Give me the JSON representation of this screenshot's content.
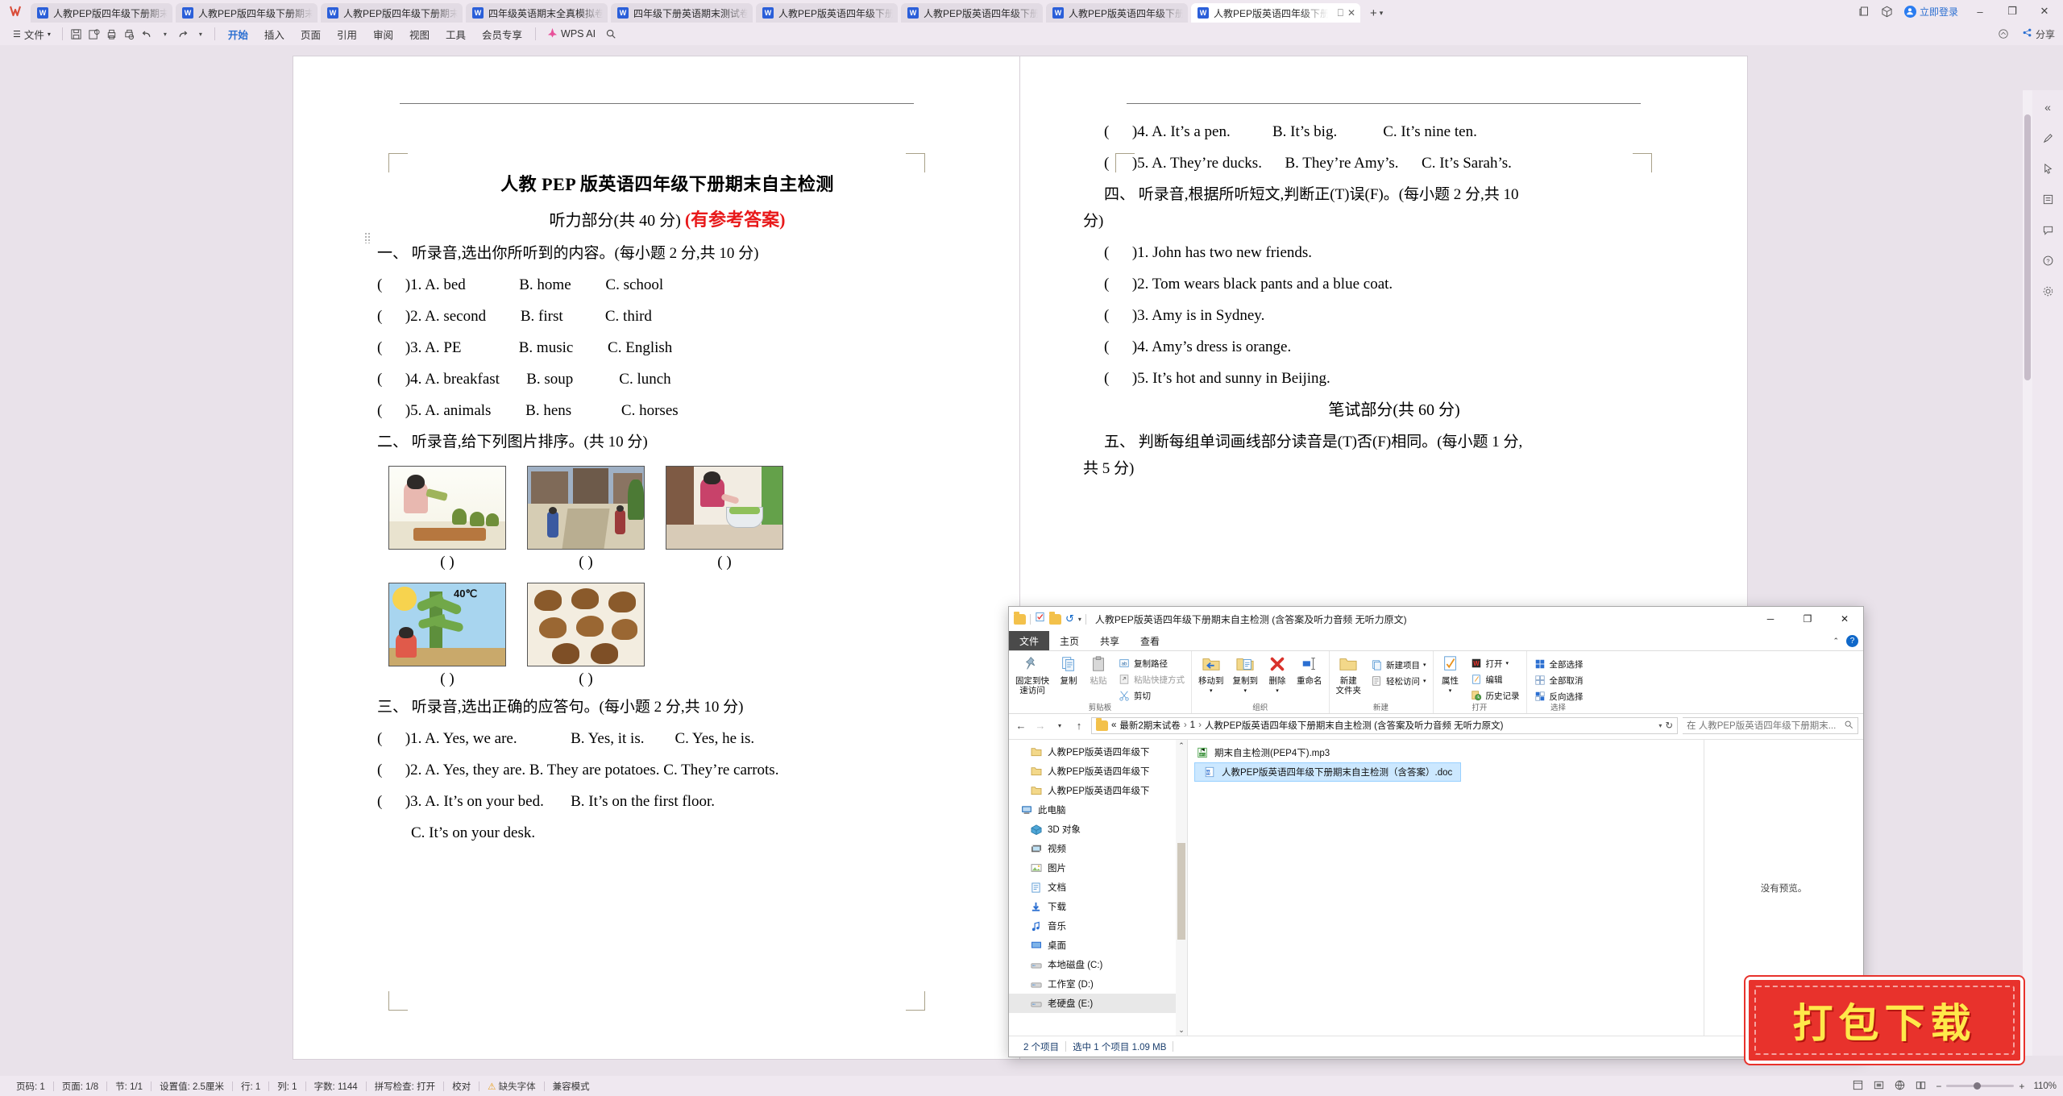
{
  "app": {
    "tabs": [
      {
        "label": "人教PEP版四年级下册期末阶段质量检",
        "icon": "word-icon",
        "active": false
      },
      {
        "label": "人教PEP版四年级下册期末阶段质量检",
        "icon": "word-icon",
        "active": false
      },
      {
        "label": "人教PEP版四年级下册期末阶段质量检",
        "icon": "word-icon",
        "active": false
      },
      {
        "label": "四年级英语期末全真模拟卷.doc",
        "icon": "word-icon",
        "active": false
      },
      {
        "label": "四年级下册英语期末测试卷(含答案).d",
        "icon": "word-icon",
        "active": false
      },
      {
        "label": "人教PEP版英语四年级下册期末测试卷",
        "icon": "word-icon",
        "active": false
      },
      {
        "label": "人教PEP版英语四年级下册期末测试卷",
        "icon": "word-icon",
        "active": false
      },
      {
        "label": "人教PEP版英语四年级下册期末达标",
        "icon": "word-icon",
        "active": false
      },
      {
        "label": "人教PEP版英语四年级下册期末自主检",
        "icon": "word-icon",
        "active": true
      }
    ],
    "new_tab_label": "+",
    "login_label": "立即登录",
    "min_label": "–",
    "restore_label": "❐",
    "close_label": "✕"
  },
  "ribbon": {
    "file_label": "文件",
    "tabs": [
      {
        "label": "开始",
        "active": true
      },
      {
        "label": "插入",
        "active": false
      },
      {
        "label": "页面",
        "active": false
      },
      {
        "label": "引用",
        "active": false
      },
      {
        "label": "审阅",
        "active": false
      },
      {
        "label": "视图",
        "active": false
      },
      {
        "label": "工具",
        "active": false
      },
      {
        "label": "会员专享",
        "active": false
      }
    ],
    "ai_label": "WPS AI",
    "search_label": "搜索",
    "share_label": "分享"
  },
  "document": {
    "title": "人教 PEP 版英语四年级下册期末自主检测",
    "subtitle_plain": "听力部分(共 40 分) ",
    "subtitle_red": "(有参考答案)",
    "left_page": {
      "section1": "一、 听录音,选出你所听到的内容。(每小题 2 分,共 10 分)",
      "q1": [
        "(      )1. A. bed              B. home         C. school",
        "(      )2. A. second         B. first           C. third",
        "(      )3. A. PE               B. music         C. English",
        "(      )4. A. breakfast       B. soup            C. lunch",
        "(      )5. A. animals         B. hens             C. horses"
      ],
      "section2": "二、 听录音,给下列图片排序。(共 10 分)",
      "bracket": "(        )",
      "image_alt_row1": [
        "girl-watering-plants",
        "village-street-scene",
        "girl-washing-vegetables"
      ],
      "image_alt_row2": [
        "sunny-40c-weather",
        "brown-hens"
      ],
      "temperature_label": "40℃",
      "section3": "三、 听录音,选出正确的应答句。(每小题 2 分,共 10 分)",
      "q3": [
        "(      )1. A. Yes, we are.              B. Yes, it is.        C. Yes, he is.",
        "(      )2. A. Yes, they are. B. They are potatoes. C. They’re carrots.",
        "(      )3. A. It’s on your bed.       B. It’s on the first floor.",
        "C. It’s on your desk."
      ]
    },
    "right_page": {
      "q3cont": [
        "(      )4. A. It’s a pen.           B. It’s big.            C. It’s nine ten.",
        "(      )5. A. They’re ducks.      B. They’re Amy’s.      C. It’s Sarah’s."
      ],
      "section4": "四、 听录音,根据所听短文,判断正(T)误(F)。(每小题 2 分,共 10",
      "section4_cont": "分)",
      "q4": [
        "(      )1. John has two new friends.",
        "(      )2. Tom wears black pants and a blue coat.",
        "(      )3. Amy is in Sydney.",
        "(      )4. Amy’s dress is orange.",
        "(      )5. It’s hot and sunny in Beijing."
      ],
      "written_part": "笔试部分(共 60 分)",
      "section5": "五、 判断每组单词画线部分读音是(T)否(F)相同。(每小题 1 分,",
      "section5_cont": "共 5 分)"
    }
  },
  "status_bar": {
    "items": [
      "页码: 1",
      "页面: 1/8",
      "节: 1/1",
      "设置值: 2.5厘米",
      "行: 1",
      "列: 1",
      "字数: 1144",
      "拼写检查: 打开",
      "校对",
      "缺失字体",
      "兼容模式"
    ],
    "zoom": "110%",
    "zoom_minus": "−",
    "zoom_plus": "+"
  },
  "explorer": {
    "title": "人教PEP版英语四年级下册期末自主检测 (含答案及听力音频 无听力原文)",
    "window_buttons": {
      "min": "─",
      "max": "❐",
      "close": "✕"
    },
    "menus": [
      "文件",
      "主页",
      "共享",
      "查看"
    ],
    "ribbon_groups": [
      {
        "label": "剪贴板",
        "big": [
          {
            "label": "固定到快\n速访问",
            "icon": "pin-icon"
          },
          {
            "label": "复制",
            "icon": "copy-icon"
          },
          {
            "label": "粘贴",
            "icon": "paste-icon"
          }
        ],
        "small": [
          {
            "label": "复制路径",
            "icon": "copy-path-icon"
          },
          {
            "label": "粘贴快捷方式",
            "icon": "paste-shortcut-icon"
          },
          {
            "label": "剪切",
            "icon": "scissors-icon"
          }
        ]
      },
      {
        "label": "组织",
        "big": [
          {
            "label": "移动到",
            "icon": "move-to-icon"
          },
          {
            "label": "复制到",
            "icon": "copy-to-icon"
          },
          {
            "label": "删除",
            "icon": "delete-icon"
          },
          {
            "label": "重命名",
            "icon": "rename-icon"
          }
        ],
        "small": []
      },
      {
        "label": "新建",
        "big": [
          {
            "label": "新建\n文件夹",
            "icon": "new-folder-icon"
          }
        ],
        "small": [
          {
            "label": "新建项目",
            "icon": "new-item-icon"
          },
          {
            "label": "轻松访问",
            "icon": "easy-access-icon"
          }
        ]
      },
      {
        "label": "打开",
        "big": [
          {
            "label": "属性",
            "icon": "properties-icon"
          }
        ],
        "small": [
          {
            "label": "打开",
            "icon": "open-word-icon"
          },
          {
            "label": "编辑",
            "icon": "edit-icon"
          },
          {
            "label": "历史记录",
            "icon": "history-icon"
          }
        ]
      },
      {
        "label": "选择",
        "big": [],
        "small": [
          {
            "label": "全部选择",
            "icon": "select-all-icon"
          },
          {
            "label": "全部取消",
            "icon": "select-none-icon"
          },
          {
            "label": "反向选择",
            "icon": "invert-selection-icon"
          }
        ]
      }
    ],
    "address": {
      "crumbs": [
        "最新2期末试卷",
        "1",
        "人教PEP版英语四年级下册期末自主检测 (含答案及听力音频 无听力原文)"
      ],
      "search_placeholder": "在 人教PEP版英语四年级下册期末..."
    },
    "nav_items": [
      {
        "label": "人教PEP版英语四年级下",
        "icon": "folder-icon",
        "indent": 1
      },
      {
        "label": "人教PEP版英语四年级下",
        "icon": "folder-icon",
        "indent": 1
      },
      {
        "label": "人教PEP版英语四年级下",
        "icon": "folder-icon",
        "indent": 1
      },
      {
        "label": "此电脑",
        "icon": "this-pc-icon",
        "indent": 0
      },
      {
        "label": "3D 对象",
        "icon": "3d-objects-icon",
        "indent": 1
      },
      {
        "label": "视频",
        "icon": "videos-icon",
        "indent": 1
      },
      {
        "label": "图片",
        "icon": "pictures-icon",
        "indent": 1
      },
      {
        "label": "文档",
        "icon": "documents-icon",
        "indent": 1
      },
      {
        "label": "下载",
        "icon": "downloads-icon",
        "indent": 1
      },
      {
        "label": "音乐",
        "icon": "music-icon",
        "indent": 1
      },
      {
        "label": "桌面",
        "icon": "desktop-icon",
        "indent": 1
      },
      {
        "label": "本地磁盘 (C:)",
        "icon": "drive-icon",
        "indent": 1
      },
      {
        "label": "工作室 (D:)",
        "icon": "drive-icon",
        "indent": 1
      },
      {
        "label": "老硬盘 (E:)",
        "icon": "drive-icon",
        "indent": 1
      }
    ],
    "files": [
      {
        "name": "期末自主检测(PEP4下).mp3",
        "icon": "mp3-icon",
        "selected": false
      },
      {
        "name": "人教PEP版英语四年级下册期末自主检测（含答案）.doc",
        "icon": "word-doc-icon",
        "selected": true
      }
    ],
    "preview_text": "没有预览。",
    "status": [
      "2 个项目",
      "选中 1 个项目  1.09 MB"
    ]
  },
  "watermark": {
    "text": "打包下载"
  },
  "colors": {
    "accent": "#2b6fd1",
    "wps_bg": "#efe8f0",
    "red": "#e8191a",
    "watermark_bg": "#e8322c",
    "watermark_fg": "#ffe94a",
    "selection": "#cce8ff"
  }
}
